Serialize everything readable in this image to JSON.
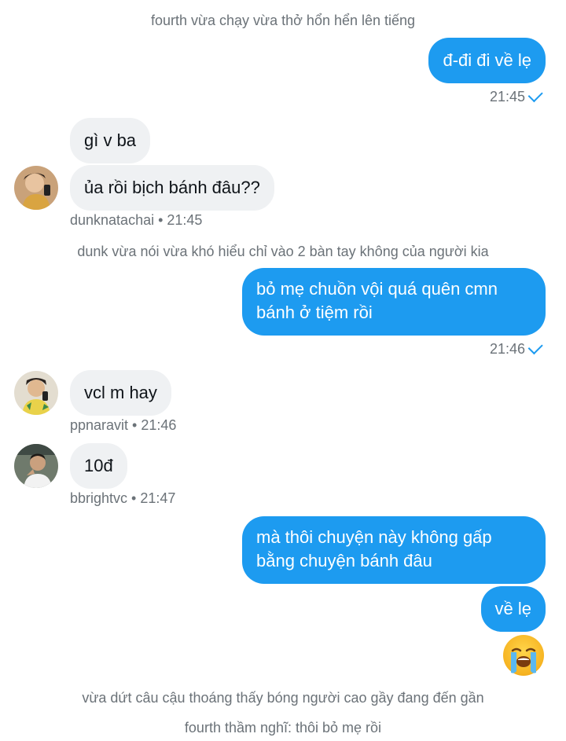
{
  "narration": {
    "line1": "fourth vừa chạy vừa thở hổn hển lên tiếng",
    "line2": "dunk vừa nói vừa khó hiểu chỉ vào 2 bàn tay không của người kia",
    "line3": "vừa dứt câu cậu thoáng thấy bóng người cao gầy đang đến gần",
    "line4": "fourth thầm nghĩ: thôi bỏ mẹ rồi"
  },
  "messages": {
    "m1": {
      "text": "đ-đi đi về lẹ",
      "time": "21:45"
    },
    "m2": {
      "text": "gì v ba"
    },
    "m3": {
      "text": "ủa rồi bịch bánh đâu??",
      "meta": "dunknatachai • 21:45"
    },
    "m4": {
      "line1": "bỏ mẹ chuồn vội quá quên cmn",
      "line2": "bánh ở tiệm rồi",
      "time": "21:46"
    },
    "m5": {
      "text": "vcl m hay",
      "meta": "ppnaravit • 21:46"
    },
    "m6": {
      "text": "10đ",
      "meta": "bbrightvc • 21:47"
    },
    "m7": {
      "line1": "mà thôi chuyện này không gấp",
      "line2": "bằng chuyện bánh đâu"
    },
    "m8": {
      "text": "về lẹ"
    },
    "m9": {
      "emoji": "loudly-crying-face"
    }
  },
  "colors": {
    "outgoing": "#1d9bf0",
    "incoming": "#eff1f3",
    "meta": "#6b7278"
  }
}
